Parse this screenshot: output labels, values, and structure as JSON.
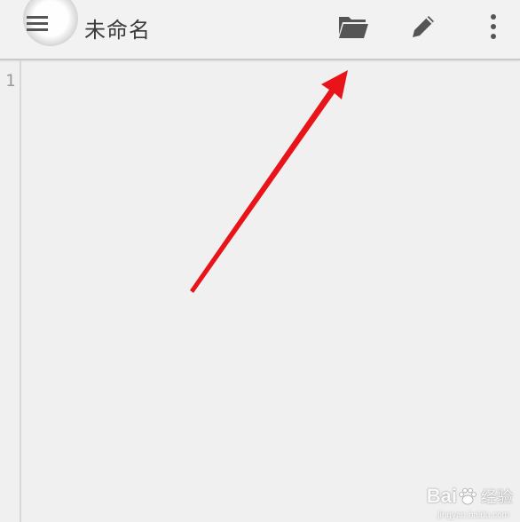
{
  "toolbar": {
    "title": "未命名",
    "menu_icon": "hamburger-menu-icon",
    "folder_icon": "folder-open-icon",
    "edit_icon": "pencil-icon",
    "more_icon": "more-vert-icon"
  },
  "editor": {
    "line_numbers": [
      "1"
    ],
    "content": ""
  },
  "annotation": {
    "arrow_color": "#e8141a"
  },
  "watermark": {
    "brand_left": "Bai",
    "brand_right": "经验",
    "url": "jingyan.baidu.com"
  },
  "colors": {
    "toolbar_bg": "#f2f2f2",
    "icon": "#555555",
    "text": "#3a3a3a",
    "editor_bg": "#f0f0f0"
  }
}
